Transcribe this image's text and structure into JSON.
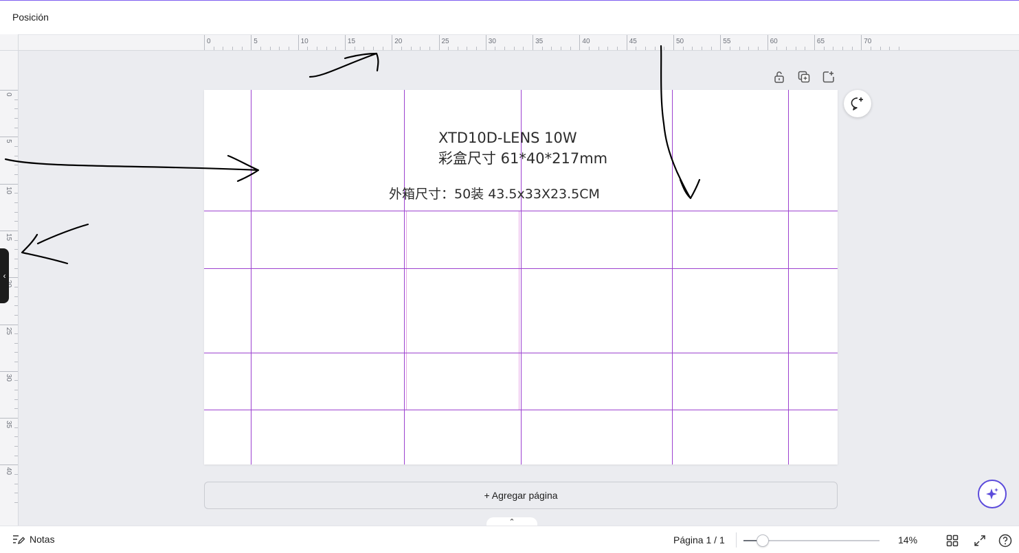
{
  "header": {
    "title": "Posición"
  },
  "ruler": {
    "top_labels": [
      "0",
      "5",
      "10",
      "15",
      "20",
      "25",
      "30",
      "35",
      "40",
      "45",
      "50",
      "55",
      "60",
      "65",
      "70"
    ],
    "left_labels": [
      "0",
      "5",
      "10",
      "15",
      "20",
      "25",
      "30",
      "35",
      "40"
    ]
  },
  "page": {
    "line1": "XTD10D-LENS 10W",
    "line2": "彩盒尺寸 61*40*217mm",
    "line3": "外箱尺寸：50装 43.5x33X23.5CM"
  },
  "page_tools": [
    "lock-icon",
    "duplicate-page-icon",
    "add-page-icon"
  ],
  "add_page_label": "+ Agregar página",
  "footer": {
    "notes_label": "Notas",
    "page_info": "Página 1 / 1",
    "zoom_label": "14%",
    "zoom_value": 0.14
  },
  "colors": {
    "guide_lines": "#9b3fcf",
    "accent": "#5b4bdb",
    "canvas_bg": "#ebecf0"
  }
}
